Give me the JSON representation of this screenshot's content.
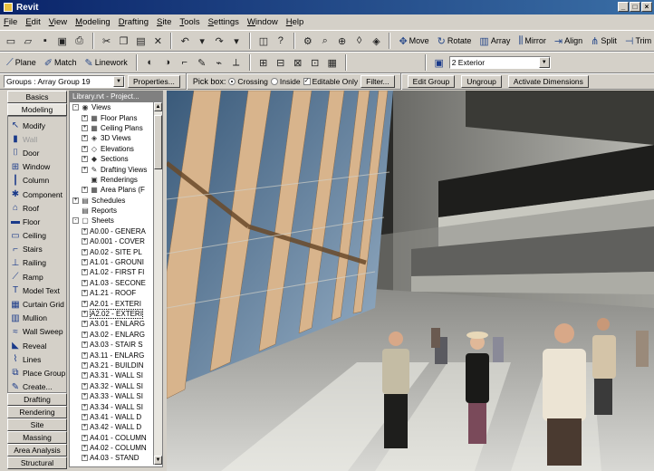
{
  "app": {
    "title": "Revit"
  },
  "menu": [
    "File",
    "Edit",
    "View",
    "Modeling",
    "Drafting",
    "Site",
    "Tools",
    "Settings",
    "Window",
    "Help"
  ],
  "toolbar2": {
    "tools": [
      "Move",
      "Rotate",
      "Array",
      "Mirror",
      "Align",
      "Split",
      "Trim"
    ],
    "view_select": "2 Exterior"
  },
  "toolbar_work": {
    "tools": [
      "Plane",
      "Match",
      "Linework"
    ]
  },
  "options_bar": {
    "group_select": "Groups : Array Group 19",
    "properties": "Properties...",
    "pick_box_label": "Pick box:",
    "crossing": "Crossing",
    "inside": "Inside",
    "editable_only": "Editable Only",
    "filter": "Filter...",
    "edit_group": "Edit Group",
    "ungroup": "Ungroup",
    "activate_dimensions": "Activate Dimensions"
  },
  "palette": {
    "top_tabs": [
      "Basics",
      "Modeling"
    ],
    "items": [
      {
        "label": "Modify",
        "icon": "arrow-icon"
      },
      {
        "label": "Wall",
        "icon": "wall-icon"
      },
      {
        "label": "Door",
        "icon": "door-icon"
      },
      {
        "label": "Window",
        "icon": "window-icon"
      },
      {
        "label": "Column",
        "icon": "column-icon"
      },
      {
        "label": "Component",
        "icon": "component-icon"
      },
      {
        "label": "Roof",
        "icon": "roof-icon"
      },
      {
        "label": "Floor",
        "icon": "floor-icon"
      },
      {
        "label": "Ceiling",
        "icon": "ceiling-icon"
      },
      {
        "label": "Stairs",
        "icon": "stairs-icon"
      },
      {
        "label": "Railing",
        "icon": "railing-icon"
      },
      {
        "label": "Ramp",
        "icon": "ramp-icon"
      },
      {
        "label": "Model Text",
        "icon": "text-icon"
      },
      {
        "label": "Curtain Grid",
        "icon": "grid-icon"
      },
      {
        "label": "Mullion",
        "icon": "mullion-icon"
      },
      {
        "label": "Wall Sweep",
        "icon": "sweep-icon"
      },
      {
        "label": "Reveal",
        "icon": "reveal-icon"
      },
      {
        "label": "Lines",
        "icon": "lines-icon"
      },
      {
        "label": "Place Group",
        "icon": "group-icon"
      },
      {
        "label": "Create...",
        "icon": "create-icon"
      }
    ],
    "bottom_tabs": [
      "Drafting",
      "Rendering",
      "Site",
      "Massing",
      "Area Analysis",
      "Structural"
    ]
  },
  "project_browser": {
    "header": "Library.rvt - Project...",
    "rows": [
      {
        "indent": 0,
        "pm": "-",
        "icon": "◉",
        "label": "Views"
      },
      {
        "indent": 1,
        "pm": "+",
        "icon": "▦",
        "label": "Floor Plans"
      },
      {
        "indent": 1,
        "pm": "+",
        "icon": "▦",
        "label": "Ceiling Plans"
      },
      {
        "indent": 1,
        "pm": "+",
        "icon": "◈",
        "label": "3D Views"
      },
      {
        "indent": 1,
        "pm": "+",
        "icon": "◇",
        "label": "Elevations"
      },
      {
        "indent": 1,
        "pm": "+",
        "icon": "◆",
        "label": "Sections"
      },
      {
        "indent": 1,
        "pm": "+",
        "icon": "✎",
        "label": "Drafting Views"
      },
      {
        "indent": 1,
        "pm": "",
        "icon": "▣",
        "label": "Renderings"
      },
      {
        "indent": 1,
        "pm": "+",
        "icon": "▦",
        "label": "Area Plans (F"
      },
      {
        "indent": 0,
        "pm": "+",
        "icon": "▤",
        "label": "Schedules"
      },
      {
        "indent": 0,
        "pm": "",
        "icon": "▤",
        "label": "Reports"
      },
      {
        "indent": 0,
        "pm": "-",
        "icon": "▢",
        "label": "Sheets"
      },
      {
        "indent": 1,
        "pm": "+",
        "icon": "",
        "label": "A0.00 - GENERA"
      },
      {
        "indent": 1,
        "pm": "+",
        "icon": "",
        "label": "A0.001 - COVER"
      },
      {
        "indent": 1,
        "pm": "+",
        "icon": "",
        "label": "A0.02 - SITE PL"
      },
      {
        "indent": 1,
        "pm": "+",
        "icon": "",
        "label": "A1.01 - GROUNI"
      },
      {
        "indent": 1,
        "pm": "+",
        "icon": "",
        "label": "A1.02 - FIRST FI"
      },
      {
        "indent": 1,
        "pm": "+",
        "icon": "",
        "label": "A1.03 - SECONE"
      },
      {
        "indent": 1,
        "pm": "+",
        "icon": "",
        "label": "A1.21 - ROOF"
      },
      {
        "indent": 1,
        "pm": "+",
        "icon": "",
        "label": "A2.01 - EXTERI"
      },
      {
        "indent": 1,
        "pm": "+",
        "icon": "",
        "label": "A2.02 - EXTERI",
        "selected": true
      },
      {
        "indent": 1,
        "pm": "+",
        "icon": "",
        "label": "A3.01 - ENLARG"
      },
      {
        "indent": 1,
        "pm": "+",
        "icon": "",
        "label": "A3.02 - ENLARG"
      },
      {
        "indent": 1,
        "pm": "+",
        "icon": "",
        "label": "A3.03 - STAIR S"
      },
      {
        "indent": 1,
        "pm": "+",
        "icon": "",
        "label": "A3.11 - ENLARG"
      },
      {
        "indent": 1,
        "pm": "+",
        "icon": "",
        "label": "A3.21 - BUILDIN"
      },
      {
        "indent": 1,
        "pm": "+",
        "icon": "",
        "label": "A3.31 - WALL SI"
      },
      {
        "indent": 1,
        "pm": "+",
        "icon": "",
        "label": "A3.32 - WALL SI"
      },
      {
        "indent": 1,
        "pm": "+",
        "icon": "",
        "label": "A3.33 - WALL SI"
      },
      {
        "indent": 1,
        "pm": "+",
        "icon": "",
        "label": "A3.34 - WALL SI"
      },
      {
        "indent": 1,
        "pm": "+",
        "icon": "",
        "label": "A3.41 - WALL D"
      },
      {
        "indent": 1,
        "pm": "+",
        "icon": "",
        "label": "A3.42 - WALL D"
      },
      {
        "indent": 1,
        "pm": "+",
        "icon": "",
        "label": "A4.01 - COLUMN"
      },
      {
        "indent": 1,
        "pm": "+",
        "icon": "",
        "label": "A4.02 - COLUMN"
      },
      {
        "indent": 1,
        "pm": "+",
        "icon": "",
        "label": "A4.03 - STAND"
      }
    ]
  }
}
